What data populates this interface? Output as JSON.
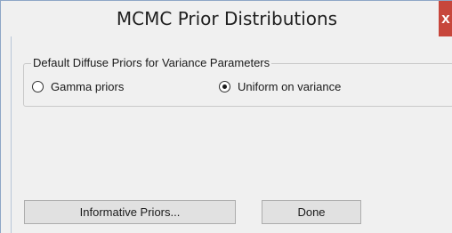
{
  "window": {
    "title": "MCMC Prior Distributions",
    "close_label": "x"
  },
  "group": {
    "legend": "Default Diffuse Priors for Variance Parameters",
    "options": [
      {
        "label": "Gamma priors",
        "selected": false
      },
      {
        "label": "Uniform on variance",
        "selected": true
      }
    ]
  },
  "buttons": {
    "informative_label": "Informative Priors...",
    "done_label": "Done"
  },
  "colors": {
    "dialog_bg": "#f0f0f0",
    "close_button": "#c7463b",
    "button_face": "#e1e1e1",
    "button_border": "#adadad"
  }
}
